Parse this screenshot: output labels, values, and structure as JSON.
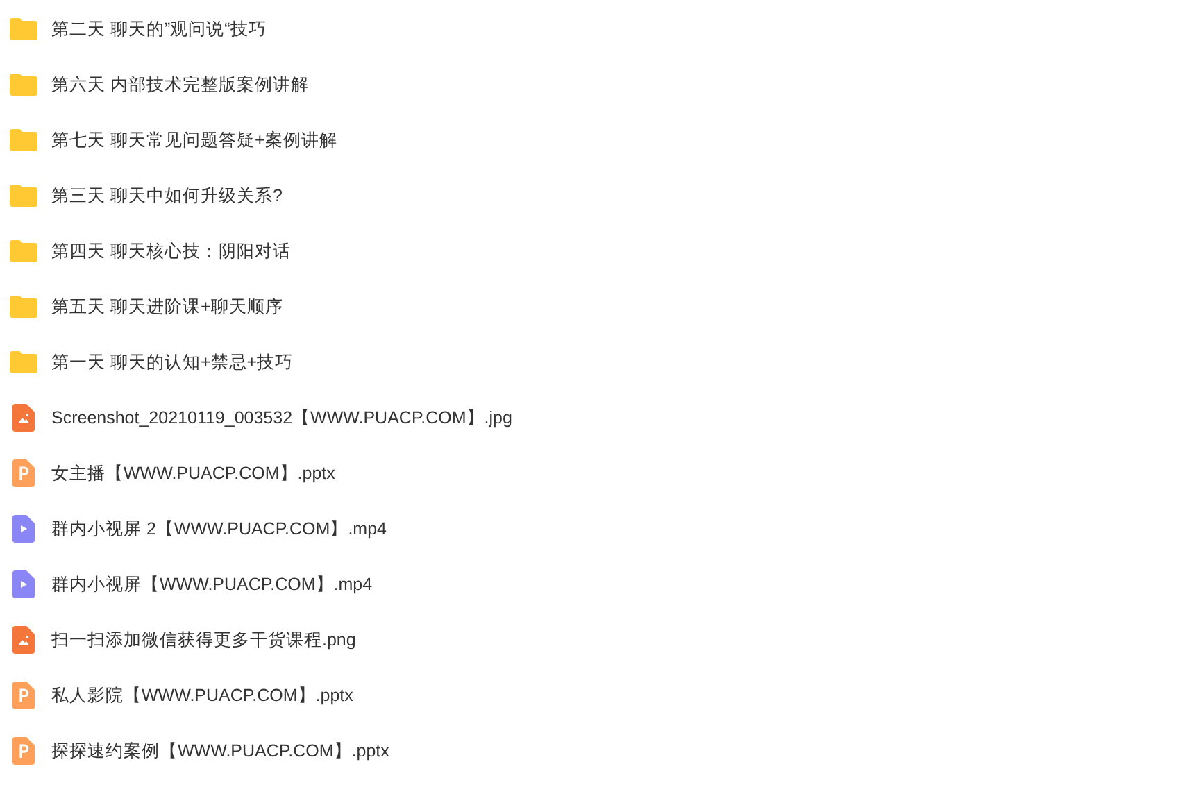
{
  "files": [
    {
      "kind": "folder",
      "name": "第二天 聊天的”观问说“技巧"
    },
    {
      "kind": "folder",
      "name": "第六天 内部技术完整版案例讲解"
    },
    {
      "kind": "folder",
      "name": "第七天 聊天常见问题答疑+案例讲解"
    },
    {
      "kind": "folder",
      "name": "第三天 聊天中如何升级关系?"
    },
    {
      "kind": "folder",
      "name": "第四天 聊天核心技：阴阳对话"
    },
    {
      "kind": "folder",
      "name": "第五天 聊天进阶课+聊天顺序"
    },
    {
      "kind": "folder",
      "name": "第一天 聊天的认知+禁忌+技巧"
    },
    {
      "kind": "image",
      "name": "Screenshot_20210119_003532【WWW.PUACP.COM】.jpg"
    },
    {
      "kind": "ppt",
      "name": "女主播【WWW.PUACP.COM】.pptx"
    },
    {
      "kind": "video",
      "name": "群内小视屏 2【WWW.PUACP.COM】.mp4"
    },
    {
      "kind": "video",
      "name": "群内小视屏【WWW.PUACP.COM】.mp4"
    },
    {
      "kind": "image",
      "name": "扫一扫添加微信获得更多干货课程.png"
    },
    {
      "kind": "ppt",
      "name": "私人影院【WWW.PUACP.COM】.pptx"
    },
    {
      "kind": "ppt",
      "name": "探探速约案例【WWW.PUACP.COM】.pptx"
    }
  ]
}
